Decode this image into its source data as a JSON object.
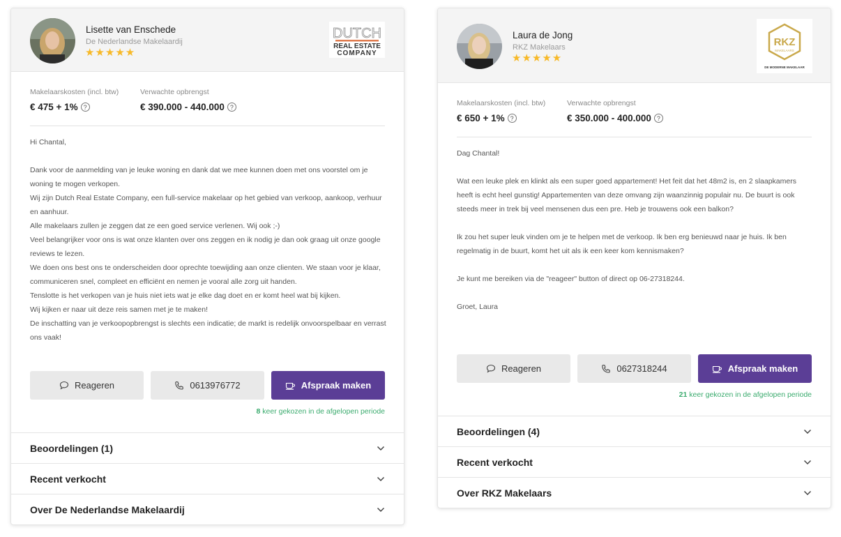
{
  "cards": [
    {
      "agent_name": "Lisette van Enschede",
      "office": "De Nederlandse Makelaardij",
      "stars": "★★★★★",
      "logo": {
        "line1": "DUTCH",
        "line2": "REAL ESTATE",
        "line3": "COMPANY"
      },
      "cost_label": "Makelaarskosten (incl. btw)",
      "cost_value": "€ 475 + 1%",
      "proceeds_label": "Verwachte opbrengst",
      "proceeds_value": "€ 390.000 - 440.000",
      "message": [
        "Hi Chantal,",
        "",
        "Dank voor de aanmelding van je leuke woning en dank dat we mee kunnen doen met ons voorstel om je woning te mogen verkopen.",
        "Wij zijn Dutch Real Estate Company, een full-service makelaar op het gebied van verkoop, aankoop, verhuur en aanhuur.",
        "Alle makelaars zullen je zeggen dat ze een goed service verlenen. Wij ook ;-)",
        "Veel belangrijker voor ons is wat onze klanten over ons zeggen en ik nodig je dan ook graag uit onze google reviews te lezen.",
        "We doen ons best ons te onderscheiden door oprechte toewijding aan onze clienten. We staan voor je klaar, communiceren snel, compleet en efficiënt en nemen je vooral alle zorg uit handen.",
        "Tenslotte is het verkopen van je huis niet iets wat je elke dag doet en er komt heel wat bij kijken.",
        "Wij kijken er naar uit deze reis samen met je te maken!",
        "De inschatting van je verkoopopbrengst is slechts een indicatie; de markt is redelijk onvoorspelbaar en verrast ons vaak!"
      ],
      "reply_label": "Reageren",
      "phone": "0613976772",
      "appointment_label": "Afspraak maken",
      "chosen_count": "8",
      "chosen_text": "keer gekozen in de afgelopen periode",
      "accordion": [
        "Beoordelingen (1)",
        "Recent verkocht",
        "Over De Nederlandse Makelaardij"
      ]
    },
    {
      "agent_name": "Laura de Jong",
      "office": "RKZ Makelaars",
      "stars": "★★★★★",
      "logo": {
        "line1": "RKZ",
        "line2": "MAKELAARS",
        "line3": "DE MODERNE MAKELAAR"
      },
      "cost_label": "Makelaarskosten (incl. btw)",
      "cost_value": "€ 650 + 1%",
      "proceeds_label": "Verwachte opbrengst",
      "proceeds_value": "€ 350.000 - 400.000",
      "message": [
        "Dag Chantal!",
        "",
        "Wat een leuke plek en klinkt als een super goed appartement! Het feit dat het 48m2 is, en 2 slaapkamers heeft is echt heel gunstig! Appartementen van deze omvang zijn waanzinnig populair nu. De buurt is ook steeds meer in trek bij veel mensenen dus een pre. Heb je trouwens ook een balkon?",
        "",
        "Ik zou het super leuk vinden om je te helpen met de verkoop. Ik ben erg benieuwd naar je huis. Ik ben regelmatig in de buurt, komt het uit als ik een keer kom kennismaken?",
        "",
        "Je kunt me bereiken via de \"reageer\" button of direct op 06-27318244.",
        "",
        "Groet, Laura"
      ],
      "reply_label": "Reageren",
      "phone": "0627318244",
      "appointment_label": "Afspraak maken",
      "chosen_count": "21",
      "chosen_text": "keer gekozen in de afgelopen periode",
      "accordion": [
        "Beoordelingen (4)",
        "Recent verkocht",
        "Over RKZ Makelaars"
      ]
    }
  ],
  "colors": {
    "primary": "#5b3e96",
    "star": "#f7b928",
    "chosen": "#3bab6e",
    "button_bg": "#e9e9e9"
  },
  "icons": {
    "help": "?",
    "reply": "chat-bubble-icon",
    "phone": "phone-icon",
    "appointment": "coffee-cup-icon",
    "chevron": "chevron-down-icon"
  }
}
